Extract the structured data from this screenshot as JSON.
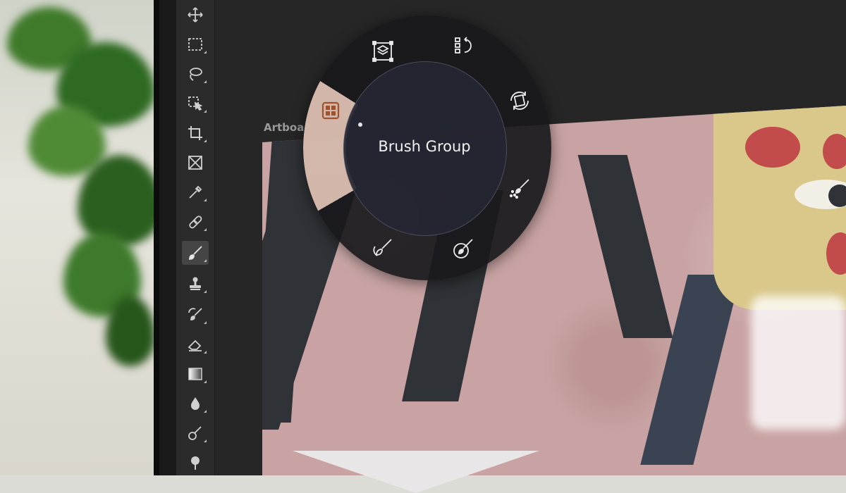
{
  "artboard": {
    "label": "Artboard 1"
  },
  "radial_menu": {
    "center_label": "Brush Group",
    "items": [
      {
        "icon": "grid-tile-icon",
        "selected": true
      },
      {
        "icon": "layer-transform-icon",
        "selected": false
      },
      {
        "icon": "reorder-rotate-icon",
        "selected": false
      },
      {
        "icon": "rotate-canvas-icon",
        "selected": false
      },
      {
        "icon": "spray-brush-icon",
        "selected": false
      },
      {
        "icon": "mixer-brush-icon",
        "selected": false
      },
      {
        "icon": "art-history-brush-icon",
        "selected": false
      }
    ]
  },
  "toolbar": {
    "tools": [
      {
        "icon": "move-icon"
      },
      {
        "icon": "rectangular-marquee-icon"
      },
      {
        "icon": "lasso-icon"
      },
      {
        "icon": "object-selection-icon"
      },
      {
        "icon": "crop-icon"
      },
      {
        "icon": "frame-icon"
      },
      {
        "icon": "eyedropper-icon"
      },
      {
        "icon": "healing-brush-icon"
      },
      {
        "icon": "brush-icon",
        "active": true
      },
      {
        "icon": "clone-stamp-icon"
      },
      {
        "icon": "history-brush-icon"
      },
      {
        "icon": "eraser-icon"
      },
      {
        "icon": "gradient-icon"
      },
      {
        "icon": "blur-icon"
      },
      {
        "icon": "dodge-icon"
      },
      {
        "icon": "pen-icon"
      }
    ]
  },
  "colors": {
    "toolbar_bg": "#2b2b2b",
    "canvas_bg": "#262626",
    "radial_bg": "#1a1a1d",
    "selected_sector": "#e6c8b9",
    "artboard": "#c9a3a3"
  }
}
